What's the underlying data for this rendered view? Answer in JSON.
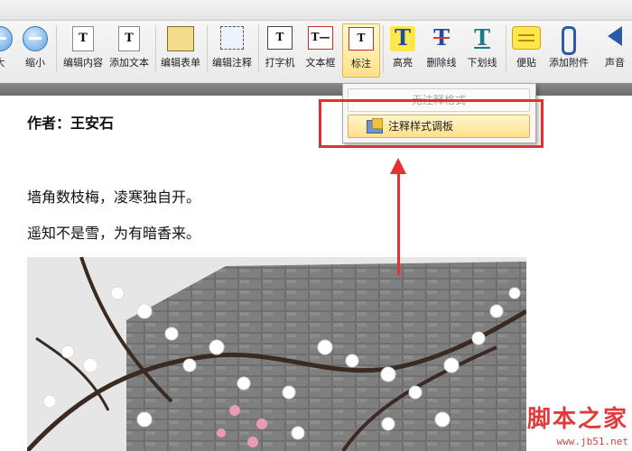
{
  "toolbar": {
    "zoom_in_label": "大",
    "zoom_out_label": "缩小",
    "edit_content_label": "编辑内容",
    "add_text_label": "添加文本",
    "edit_form_label": "编辑表单",
    "edit_annotation_label": "编辑注释",
    "typewriter_label": "打字机",
    "textbox_label": "文本框",
    "callout_label": "标注",
    "highlight_label": "高亮",
    "strikeout_label": "删除线",
    "underline_label": "下划线",
    "sticky_note_label": "便贴",
    "attach_file_label": "添加附件",
    "sound_label": "声音"
  },
  "dropdown": {
    "no_style_label": "无注释格式",
    "palette_label": "注释样式调板"
  },
  "document": {
    "author": "作者：王安石",
    "line1": "墙角数枝梅，凌寒独自开。",
    "line2": "遥知不是雪，为有暗香来。"
  },
  "watermark": {
    "brand": "脚本之家",
    "url": "www.jb51.net"
  },
  "colors": {
    "accent_red": "#e03030",
    "highlight_yellow": "#ffe94a"
  }
}
